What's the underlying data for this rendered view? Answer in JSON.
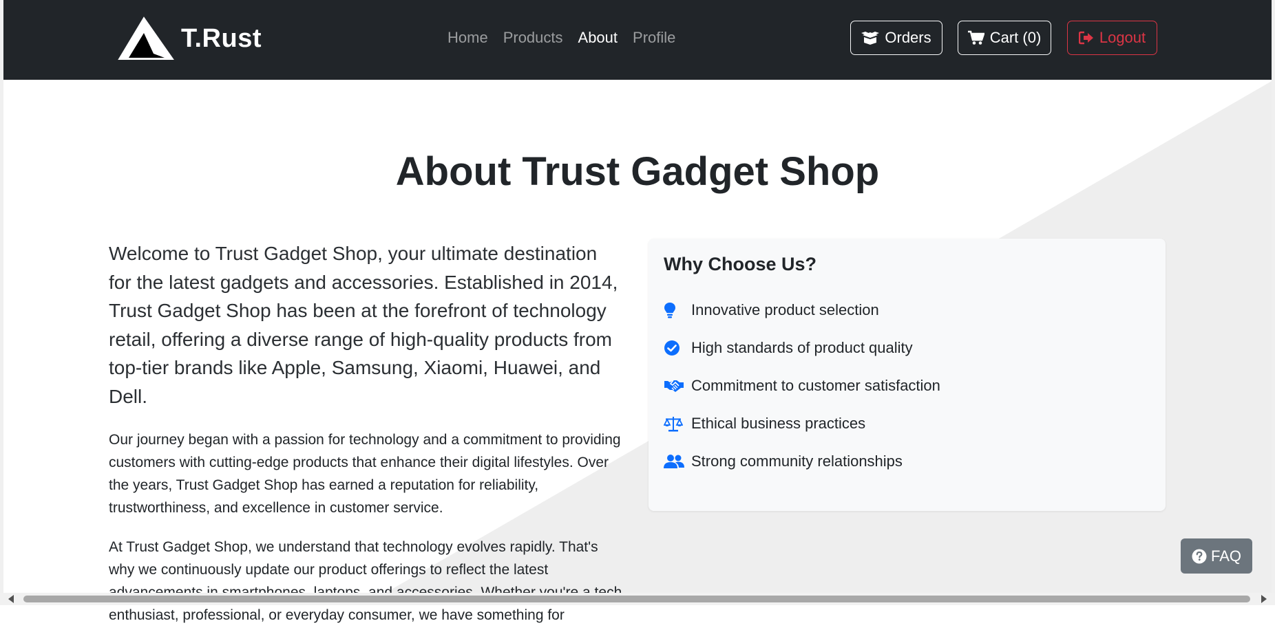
{
  "brand": {
    "name": "T.Rust",
    "logo_icon": "triangle-logo-icon"
  },
  "nav": {
    "links": [
      {
        "label": "Home",
        "active": false
      },
      {
        "label": "Products",
        "active": false
      },
      {
        "label": "About",
        "active": true
      },
      {
        "label": "Profile",
        "active": false
      }
    ]
  },
  "actions": {
    "orders_label": "Orders",
    "cart_label": "Cart (0)",
    "logout_label": "Logout"
  },
  "page": {
    "title": "About Trust Gadget Shop",
    "lead": "Welcome to Trust Gadget Shop, your ultimate destination for the latest gadgets and accessories. Established in 2014, Trust Gadget Shop has been at the forefront of technology retail, offering a diverse range of high-quality products from top-tier brands like Apple, Samsung, Xiaomi, Huawei, and Dell.",
    "paragraph1": "Our journey began with a passion for technology and a commitment to providing customers with cutting-edge products that enhance their digital lifestyles. Over the years, Trust Gadget Shop has earned a reputation for reliability, trustworthiness, and excellence in customer service.",
    "paragraph2": "At Trust Gadget Shop, we understand that technology evolves rapidly. That's why we continuously update our product offerings to reflect the latest advancements in smartphones, laptops, and accessories. Whether you're a tech enthusiast, professional, or everyday consumer, we have something for"
  },
  "why": {
    "title": "Why Choose Us?",
    "items": [
      {
        "icon": "lightbulb-icon",
        "label": "Innovative product selection"
      },
      {
        "icon": "check-circle-icon",
        "label": "High standards of product quality"
      },
      {
        "icon": "handshake-icon",
        "label": "Commitment to customer satisfaction"
      },
      {
        "icon": "balance-scale-icon",
        "label": "Ethical business practices"
      },
      {
        "icon": "users-icon",
        "label": "Strong community relationships"
      }
    ]
  },
  "faq": {
    "label": "FAQ"
  },
  "colors": {
    "navbar": "#212529",
    "accent": "#0d6efd",
    "danger": "#dc3545",
    "secondary": "#6c757d",
    "card_bg": "#f8f9fa"
  }
}
